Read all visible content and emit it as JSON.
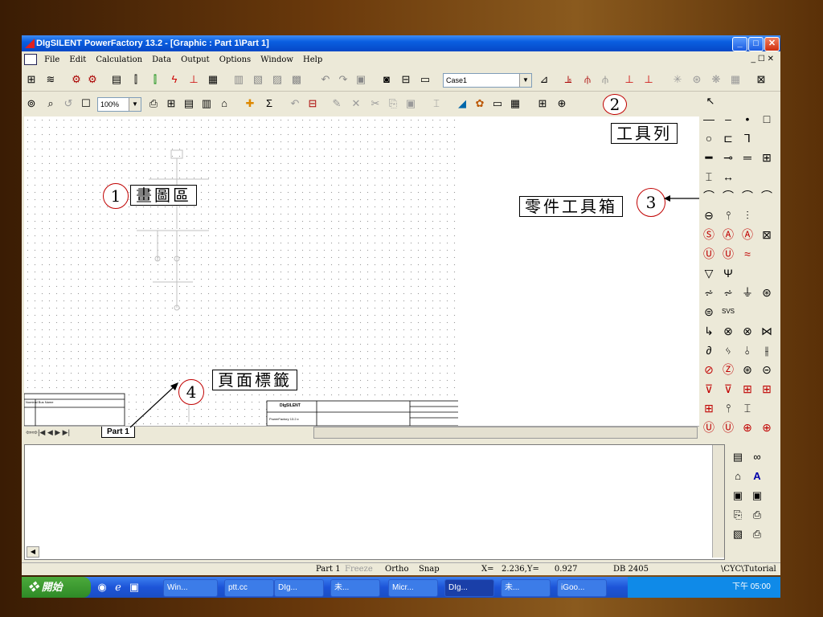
{
  "window": {
    "title": "DIgSILENT PowerFactory 13.2 - [Graphic : Part 1\\Part 1]",
    "min_glyph": "_",
    "max_glyph": "□",
    "close_glyph": "✕",
    "mdi_controls": "_ ☐ ✕"
  },
  "menu": [
    "File",
    "Edit",
    "Calculation",
    "Data",
    "Output",
    "Options",
    "Window",
    "Help"
  ],
  "toolbar": {
    "zoom_value": "100%",
    "case_value": "Case1"
  },
  "drawing": {
    "page_tab": "Part 1",
    "nav_arrows": "⇦⇨|◀ ◀ ▶ ▶|",
    "title_block_company": "DIgSILENT",
    "title_block_text": "PowerFactory 13.2.x",
    "title_block_top_left": "Nominal Bus Name"
  },
  "annotations": [
    {
      "num": "1",
      "label": "畫圖區"
    },
    {
      "num": "2",
      "label": "工具列"
    },
    {
      "num": "3",
      "label": "零件工具箱"
    },
    {
      "num": "4",
      "label": "頁面標籤"
    }
  ],
  "statusbar": {
    "part": "Part 1",
    "freeze": "Freeze",
    "ortho": "Ortho",
    "snap": "Snap",
    "coords": "X=   2.236,Y=      0.927",
    "db": "DB 2405",
    "path": "\\CYC\\Tutorial"
  },
  "taskbar": {
    "start": "開始",
    "tasks": [
      "Win...",
      "ptt.cc",
      "DIg...",
      "未...",
      "Micr...",
      "DIg...",
      "未...",
      "iGoo..."
    ],
    "clock": "下午 05:00"
  },
  "icons": {
    "tb1": [
      "grid-icon",
      "wave-icon",
      "gear-icon",
      "gear2-icon",
      "doc-icon",
      "tower-icon",
      "tower-green-icon",
      "bolt-icon",
      "relay-icon",
      "calc-icon",
      "panel-icon",
      "report-icon",
      "chart-icon",
      "edit-icon",
      "undo-icon",
      "redo-icon",
      "stop-icon",
      "camera-icon",
      "table-icon",
      "window-icon"
    ],
    "palette_colors": {
      "accent": "#c00000"
    }
  },
  "colors": {
    "titlebar": "#0a5ee0",
    "callout_red": "#c00000",
    "taskbar": "#1d54d8",
    "start_green": "#2e8a26"
  }
}
